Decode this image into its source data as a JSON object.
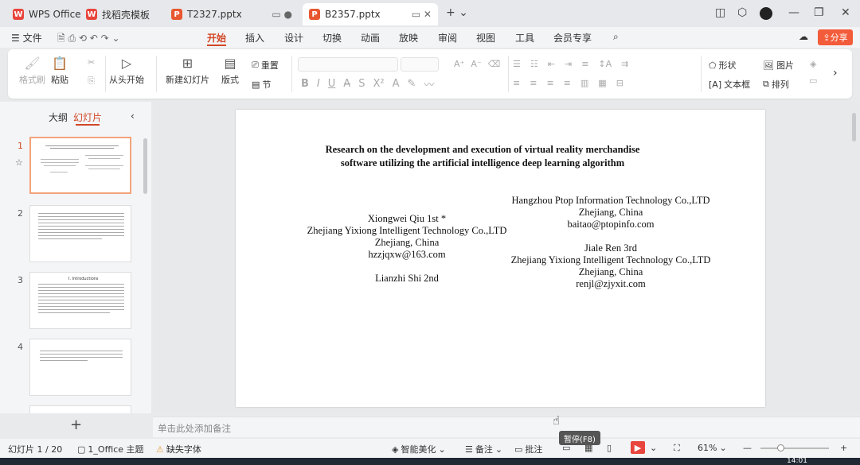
{
  "tabs": [
    {
      "label": "WPS Office",
      "icon": "wps-logo-icon",
      "color": "#e8453c"
    },
    {
      "label": "找稻壳模板",
      "icon": "docer-icon",
      "color": "#e8453c"
    },
    {
      "label": "T2327.pptx",
      "icon": "pptx-icon",
      "color": "#e8572f"
    },
    {
      "label": "B2357.pptx",
      "icon": "pptx-icon",
      "color": "#e8572f"
    }
  ],
  "menu": {
    "file": "文件",
    "items": [
      "开始",
      "插入",
      "设计",
      "切换",
      "动画",
      "放映",
      "审阅",
      "视图",
      "工具",
      "会员专享"
    ],
    "share": "分享"
  },
  "ribbon": {
    "format_painter": "格式刷",
    "paste": "粘贴",
    "play_from_start": "从头开始",
    "new_slide": "新建幻灯片",
    "layout": "版式",
    "reset": "重置",
    "section": "节",
    "shape": "形状",
    "picture": "图片",
    "textbox": "文本框",
    "arrange": "排列"
  },
  "panel": {
    "outline_tab": "大纲",
    "slides_tab": "幻灯片",
    "slide_numbers": [
      "1",
      "2",
      "3",
      "4"
    ],
    "thumb3_heading": "I. Introductions"
  },
  "slide": {
    "title_line1": "Research on the development and execution of virtual reality merchandise",
    "title_line2": "software utilizing the artificial intelligence deep learning algorithm",
    "author1_name": "Xiongwei Qiu 1st *",
    "author1_org": "Zhejiang Yixiong Intelligent Technology Co.,LTD",
    "author1_loc": "Zhejiang, China",
    "author1_email": "hzzjqxw@163.com",
    "author2_name": "Lianzhi Shi 2nd",
    "author3_org": "Hangzhou Ptop Information Technology Co.,LTD",
    "author3_loc": "Zhejiang, China",
    "author3_email": "baitao@ptopinfo.com",
    "author4_name": "Jiale Ren 3rd",
    "author4_org": "Zhejiang Yixiong Intelligent Technology Co.,LTD",
    "author4_loc": "Zhejiang, China",
    "author4_email": "renjl@zjyxit.com"
  },
  "notes_placeholder": "单击此处添加备注",
  "status": {
    "slide_count": "幻灯片 1 / 20",
    "theme": "1_Office 主题",
    "missing_font": "缺失字体",
    "beautify": "智能美化",
    "notes": "备注",
    "comments": "批注",
    "zoom": "61%",
    "tooltip": "暂停(F8)",
    "time": "14:01"
  }
}
